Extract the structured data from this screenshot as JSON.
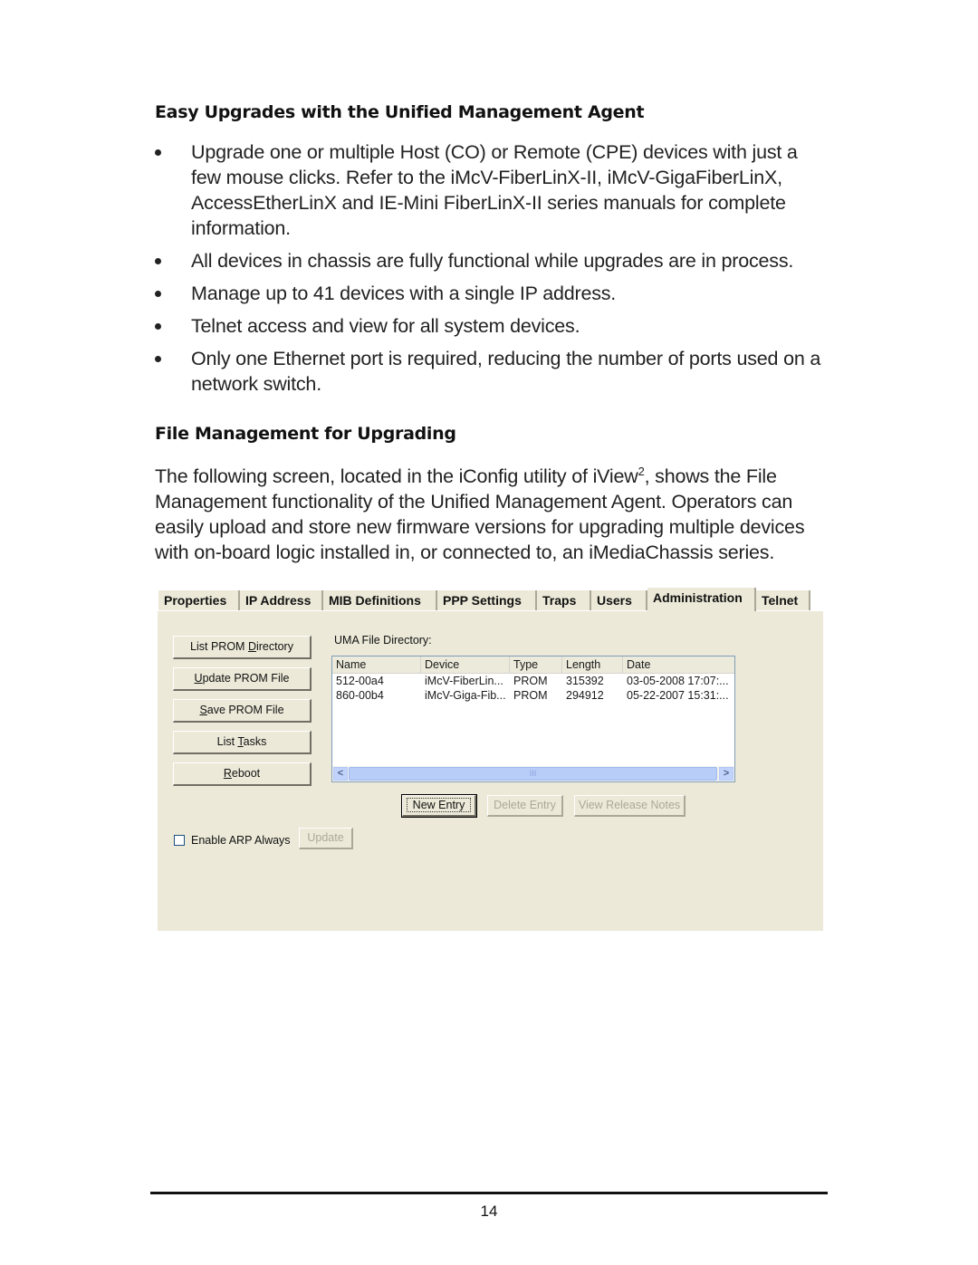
{
  "section1": {
    "heading": "Easy Upgrades with the Unified Management Agent",
    "bullets": [
      "Upgrade one or multiple Host (CO) or Remote (CPE) devices with just a few mouse clicks.  Refer to the iMcV-FiberLinX-II, iMcV-GigaFiberLinX, AccessEtherLinX and IE-Mini FiberLinX-II series manuals for complete information.",
      "All devices in chassis are fully functional while upgrades are in process.",
      "Manage up to 41 devices with a single IP address.",
      "Telnet access and view for all system devices.",
      "Only one Ethernet port is required, reducing the number of ports used on a network switch."
    ]
  },
  "section2": {
    "heading": "File Management for Upgrading",
    "paragraph_before_sup": "The following screen, located in the iConfig utility of iView",
    "superscript": "2",
    "paragraph_after_sup": ", shows the File Management functionality of the Unified Management Agent.  Operators can easily upload and store new firmware versions for upgrading multiple devices with on-board logic installed in, or connected to, an iMediaChassis series."
  },
  "dialog": {
    "tabs": [
      {
        "label": "Properties",
        "active": false
      },
      {
        "label": "IP Address",
        "active": false
      },
      {
        "label": "MIB Definitions",
        "active": false
      },
      {
        "label": "PPP Settings",
        "active": false
      },
      {
        "label": "Traps",
        "active": false
      },
      {
        "label": "Users",
        "active": false
      },
      {
        "label": "Administration",
        "active": true
      },
      {
        "label": "Telnet",
        "active": false
      }
    ],
    "left_buttons": [
      {
        "pre": "List PROM ",
        "mnemonic": "D",
        "post": "irectory"
      },
      {
        "pre": "",
        "mnemonic": "U",
        "post": "pdate PROM File"
      },
      {
        "pre": "",
        "mnemonic": "S",
        "post": "ave PROM File"
      },
      {
        "pre": "List ",
        "mnemonic": "T",
        "post": "asks"
      },
      {
        "pre": "",
        "mnemonic": "R",
        "post": "eboot"
      }
    ],
    "directory_label": "UMA File Directory:",
    "columns": [
      "Name",
      "Device",
      "Type",
      "Length",
      "Date"
    ],
    "rows": [
      [
        "512-00a4",
        "iMcV-FiberLin...",
        "PROM",
        "315392",
        "03-05-2008 17:07:..."
      ],
      [
        "860-00b4",
        "iMcV-Giga-Fib...",
        "PROM",
        "294912",
        "05-22-2007 15:31:..."
      ]
    ],
    "scroll_left": "<",
    "scroll_right": ">",
    "scroll_grip": "III",
    "new_entry": "New Entry",
    "delete_entry": "Delete Entry",
    "view_release_notes": "View Release Notes",
    "enable_arp_label": "Enable ARP Always",
    "enable_arp_checked": false,
    "update_label": "Update"
  },
  "footer": {
    "page_number": "14"
  }
}
